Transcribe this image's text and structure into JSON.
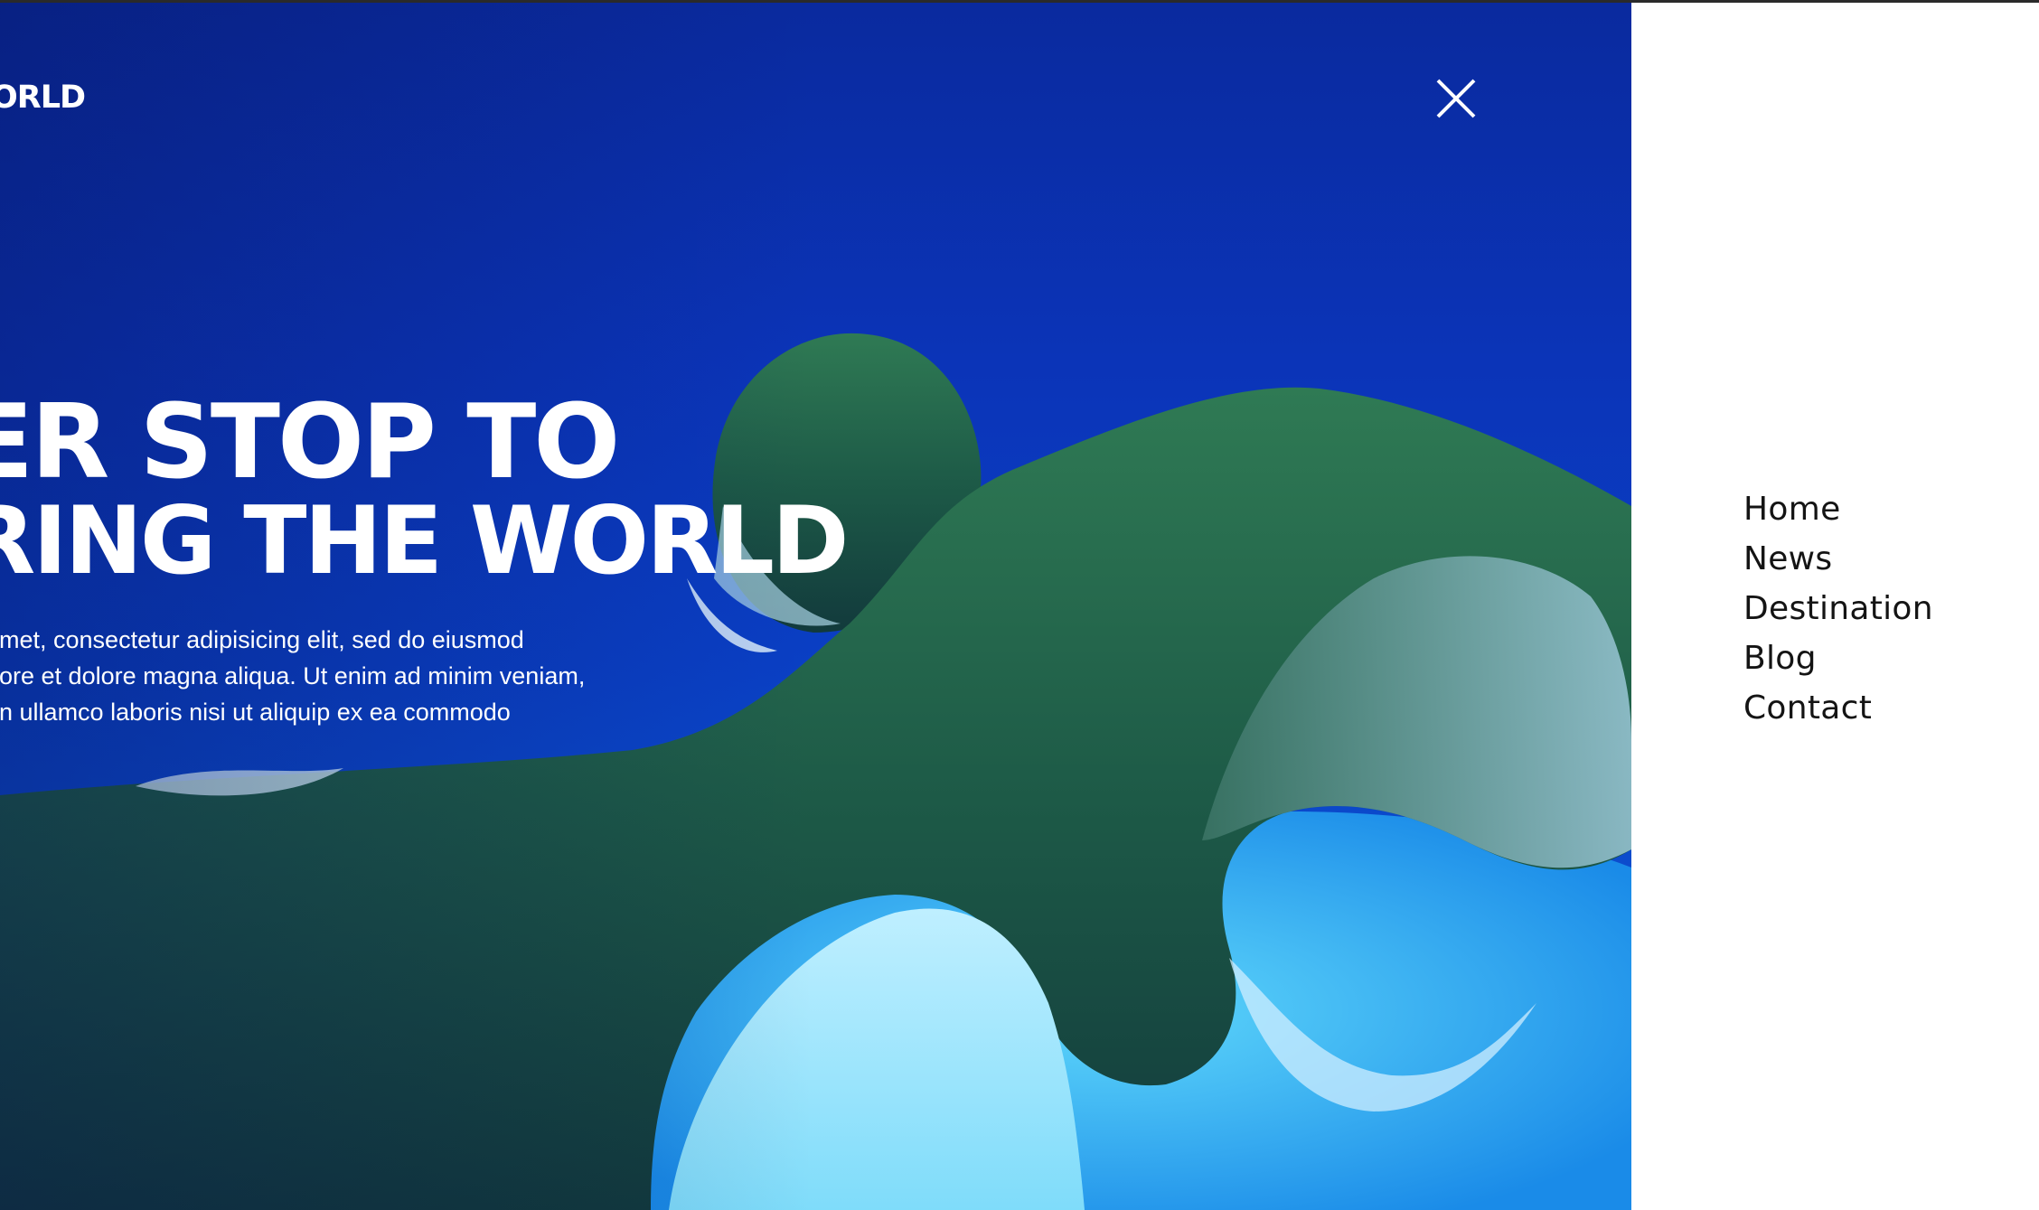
{
  "header": {
    "logo_text": "ORLD",
    "close_icon": "close-icon"
  },
  "hero": {
    "headline_line1": "ER STOP TO",
    "headline_line2": "RING THE WORLD",
    "intro_lines": [
      "amet, consectetur adipisicing elit, sed do eiusmod",
      "bore et dolore magna aliqua. Ut enim ad minim veniam,",
      "on ullamco laboris nisi ut aliquip ex ea commodo"
    ]
  },
  "menu": {
    "items": [
      {
        "label": "Home"
      },
      {
        "label": "News"
      },
      {
        "label": "Destination"
      },
      {
        "label": "Blog"
      },
      {
        "label": "Contact"
      }
    ]
  },
  "colors": {
    "ocean": "#0b34b8",
    "text_light": "#ffffff",
    "menu_text": "#141414",
    "panel_bg": "#ffffff"
  }
}
